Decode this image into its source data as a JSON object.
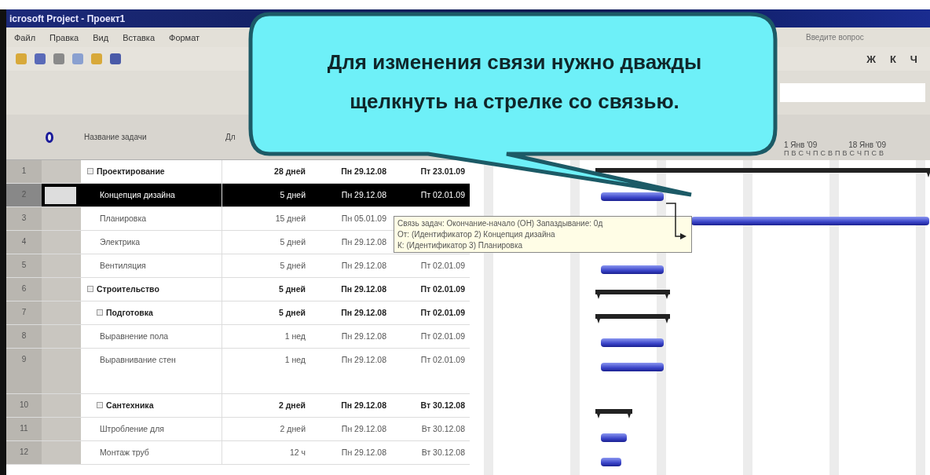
{
  "window": {
    "title": "icrosoft Project - Проект1"
  },
  "menu": [
    {
      "label": "Файл"
    },
    {
      "label": "Правка"
    },
    {
      "label": "Вид"
    },
    {
      "label": "Вставка"
    },
    {
      "label": "Формат"
    }
  ],
  "help_search": {
    "placeholder": "Введите вопрос"
  },
  "format_buttons": [
    "Ж",
    "К",
    "Ч"
  ],
  "table": {
    "columns": [
      "Название задачи",
      "Дл"
    ],
    "rows": [
      {
        "id": "1",
        "name": "Проектирование",
        "kind": "summary",
        "selected": false,
        "duration": "28 дней",
        "start": "Пн 29.12.08",
        "finish": "Пт 23.01.09"
      },
      {
        "id": "2",
        "name": "Концепция дизайна",
        "kind": "task",
        "selected": true,
        "duration": "5 дней",
        "start": "Пн 29.12.08",
        "finish": "Пт 02.01.09"
      },
      {
        "id": "3",
        "name": "Планировка",
        "kind": "task",
        "selected": false,
        "duration": "15 дней",
        "start": "Пн 05.01.09"
      },
      {
        "id": "4",
        "name": "Электрика",
        "kind": "task",
        "selected": false,
        "duration": "5 дней",
        "start": "Пн 29.12.08"
      },
      {
        "id": "5",
        "name": "Вентиляция",
        "kind": "task",
        "selected": false,
        "duration": "5 дней",
        "start": "Пн 29.12.08",
        "finish": "Пт 02.01.09"
      },
      {
        "id": "6",
        "name": "Строительство",
        "kind": "summary",
        "selected": false,
        "duration": "5 дней",
        "start": "Пн 29.12.08",
        "finish": "Пт 02.01.09"
      },
      {
        "id": "7",
        "name": "Подготовка",
        "kind": "summary",
        "selected": false,
        "duration": "5 дней",
        "start": "Пн 29.12.08",
        "finish": "Пт 02.01.09"
      },
      {
        "id": "8",
        "name": "Выравнение пола",
        "kind": "task",
        "selected": false,
        "duration": "1 нед",
        "start": "Пн 29.12.08",
        "finish": "Пт 02.01.09"
      },
      {
        "id": "9",
        "name": "Выравнивание стен",
        "kind": "task",
        "selected": false,
        "duration": "1 нед",
        "start": "Пн 29.12.08",
        "finish": "Пт 02.01.09"
      },
      {
        "id": "10",
        "name": "Сантехника",
        "kind": "summary",
        "selected": false,
        "duration": "2 дней",
        "start": "Пн 29.12.08",
        "finish": "Вт 30.12.08"
      },
      {
        "id": "11",
        "name": "Штробление для",
        "kind": "task",
        "selected": false,
        "duration": "2 дней",
        "start": "Пн 29.12.08",
        "finish": "Вт 30.12.08"
      },
      {
        "id": "12",
        "name": "Монтаж труб",
        "kind": "task",
        "selected": false,
        "duration": "12 ч",
        "start": "Пн 29.12.08",
        "finish": "Вт 30.12.08"
      }
    ]
  },
  "timescale": {
    "weeks": [
      "1 Янв '09",
      "18 Янв '09"
    ],
    "days": [
      "П",
      "В",
      "С",
      "Ч",
      "П",
      "С",
      "В",
      "П",
      "В",
      "С",
      "Ч",
      "П",
      "С",
      "В"
    ]
  },
  "tooltip": {
    "lines": [
      "Связь задач: Окончание-начало (ОН)    Запаздывание: 0д",
      "От: (Идентификатор 2) Концепция дизайна",
      "К: (Идентификатор 3) Планировка"
    ]
  },
  "callout": {
    "text": "Для изменения связи нужно дважды щелкнуть на стрелке со связью."
  }
}
